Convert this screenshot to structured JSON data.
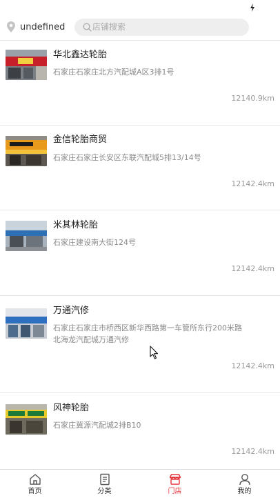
{
  "location": {
    "city": "undefined"
  },
  "search": {
    "placeholder": "店铺搜索"
  },
  "stores": [
    {
      "name": "华北鑫达轮胎",
      "address": "石家庄石家庄北方汽配城A区3排1号",
      "distance": "12140.9km"
    },
    {
      "name": "金信轮胎商贸",
      "address": "石家庄石家庄长安区东联汽配城5排13/14号",
      "distance": "12142.4km"
    },
    {
      "name": "米其林轮胎",
      "address": "石家庄建设南大街124号",
      "distance": "12142.4km"
    },
    {
      "name": "万通汽修",
      "address": "石家庄石家庄市桥西区新华西路第一车管所东行200米路北海龙汽配城万通汽修",
      "distance": "12142.4km"
    },
    {
      "name": "风神轮胎",
      "address": "石家庄冀源汽配城2排B10",
      "distance": "12142.4km"
    }
  ],
  "tabs": [
    {
      "label": "首页",
      "icon": "home-icon"
    },
    {
      "label": "分类",
      "icon": "category-icon"
    },
    {
      "label": "门店",
      "icon": "store-icon",
      "active": true
    },
    {
      "label": "我的",
      "icon": "user-icon"
    }
  ],
  "colors": {
    "accent": "#e5333a",
    "text_secondary": "#8a8a8a"
  }
}
